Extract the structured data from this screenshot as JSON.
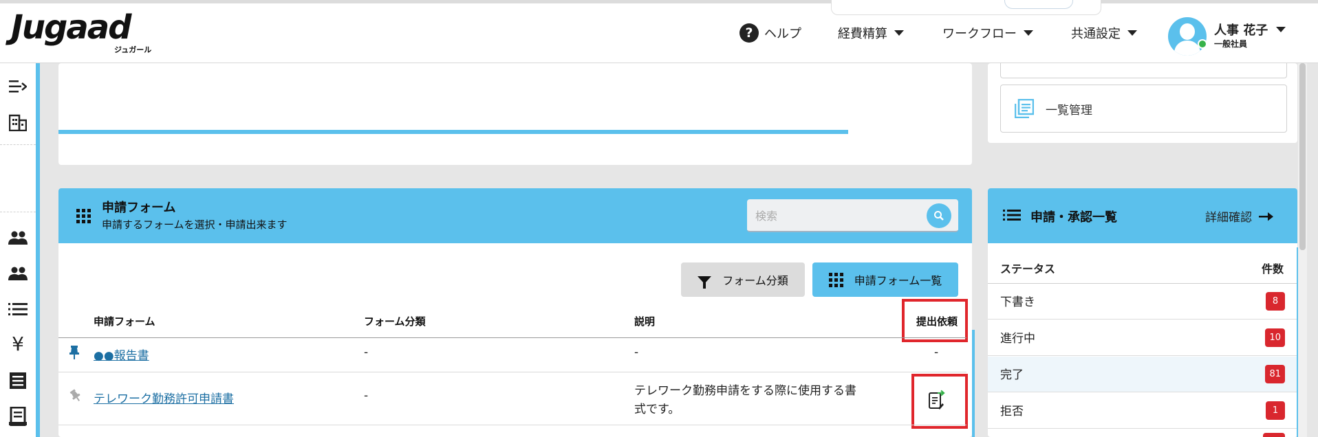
{
  "header": {
    "logo_text": "Jugaad",
    "logo_sub": "ジュガール",
    "help_label": "ヘルプ",
    "nav": [
      "経費精算",
      "ワークフロー",
      "共通設定"
    ],
    "user_name": "人事 花子",
    "user_role": "一般社員"
  },
  "sidebar": {
    "icons": [
      "collapse-icon",
      "building-icon",
      "users-icon",
      "users-icon",
      "list-icon",
      "yen-icon",
      "receipt-icon",
      "document-icon"
    ]
  },
  "side_menu": {
    "ichiran_label": "一覧管理"
  },
  "forms_card": {
    "title": "申請フォーム",
    "subtitle": "申請するフォームを選択・申請出来ます",
    "search_placeholder": "検索",
    "filter_button": "フォーム分類",
    "list_button": "申請フォーム一覧",
    "columns": [
      "申請フォーム",
      "フォーム分類",
      "説明",
      "提出依頼"
    ],
    "rows": [
      {
        "name": "●●報告書",
        "category": "-",
        "description": "-",
        "request": "-",
        "pinned": true
      },
      {
        "name": "テレワーク勤務許可申請書",
        "category": "-",
        "description_line1": "テレワーク勤務申請をする際に使用する書",
        "description_line2": "式です。",
        "pinned": false
      }
    ]
  },
  "status_card": {
    "title": "申請・承認一覧",
    "detail_link": "詳細確認",
    "col_status": "ステータス",
    "col_count": "件数",
    "rows": [
      {
        "label": "下書き",
        "count": "8"
      },
      {
        "label": "進行中",
        "count": "10"
      },
      {
        "label": "完了",
        "count": "81"
      },
      {
        "label": "拒否",
        "count": "1"
      }
    ]
  },
  "colors": {
    "accent": "#5bc0ec",
    "badge": "#d9272e",
    "highlight_box": "#e0262c",
    "link": "#1c6fa3"
  }
}
